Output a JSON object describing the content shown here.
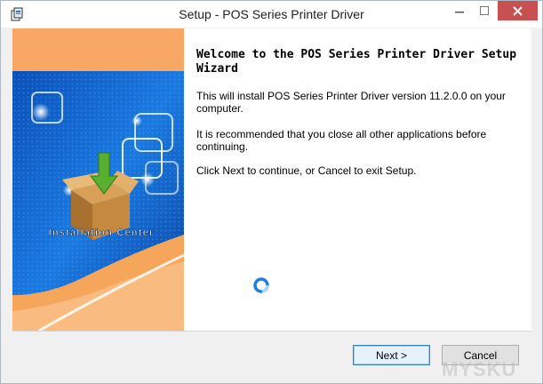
{
  "window": {
    "title": "Setup - POS Series Printer Driver",
    "app_icon": "installer-icon"
  },
  "side_panel": {
    "banner_label": "Installation Center",
    "colors": {
      "orange": "#f8a864",
      "blue": "#1a6fd8"
    }
  },
  "wizard": {
    "heading": "Welcome to the POS Series Printer Driver Setup Wizard",
    "paragraph_1": "This will install POS Series Printer Driver version 11.2.0.0 on your computer.",
    "paragraph_2": "It is recommended that you close all other applications before continuing.",
    "paragraph_3": "Click Next to continue, or Cancel to exit Setup."
  },
  "buttons": {
    "next": "Next >",
    "cancel": "Cancel"
  },
  "watermark": "MYSKU"
}
